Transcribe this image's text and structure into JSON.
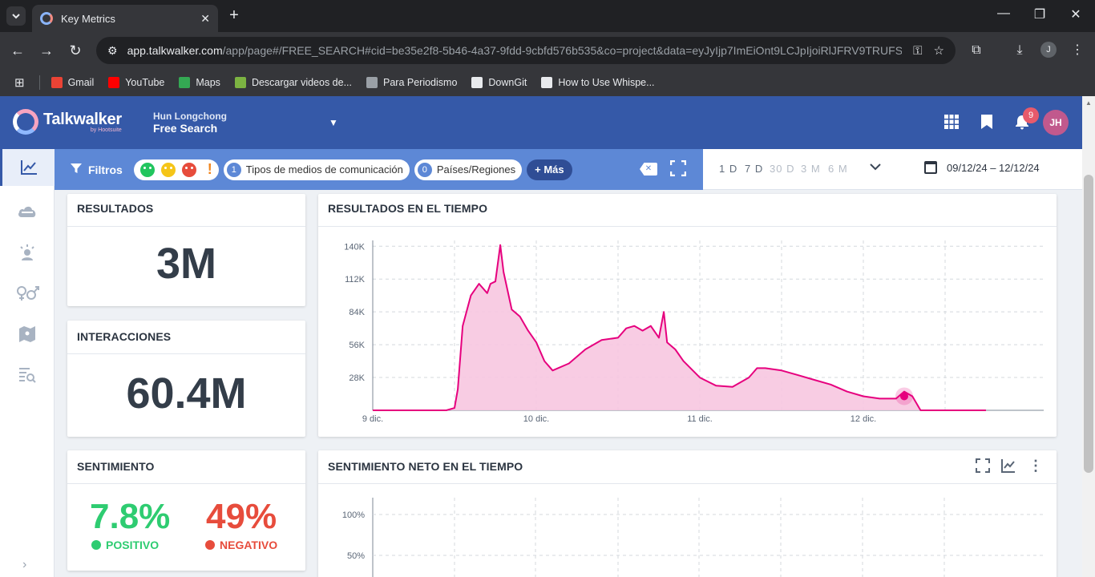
{
  "browser": {
    "tab_title": "Key Metrics",
    "url_host": "app.talkwalker.com",
    "url_path": "/app/page#/FREE_SEARCH#cid=be35e2f8-5b46-4a37-9fdd-9cbfd576b535&co=project&data=eyJyIjp7ImEiOnt9LCJpIjoiRlJFRV9TRUFS...",
    "profile_initial": "J",
    "bookmarks": [
      {
        "label": "Gmail",
        "color": "#ea4335"
      },
      {
        "label": "YouTube",
        "color": "#ff0000"
      },
      {
        "label": "Maps",
        "color": "#34a853"
      },
      {
        "label": "Descargar videos de...",
        "color": "#7cb342"
      },
      {
        "label": "Para Periodismo",
        "color": "#9aa0a6"
      },
      {
        "label": "DownGit",
        "color": "#e8eaed"
      },
      {
        "label": "How to Use Whispe...",
        "color": "#e8eaed"
      }
    ]
  },
  "header": {
    "logo_text": "Talkwalker",
    "logo_sub": "by Hootsuite",
    "user_name": "Hun Longchong",
    "project_name": "Free Search",
    "notification_count": "9",
    "avatar_initials": "JH"
  },
  "filters": {
    "label": "Filtros",
    "media_types_count": "1",
    "media_types_label": "Tipos de medios de comunicación",
    "countries_count": "0",
    "countries_label": "Países/Regiones",
    "more_label": "+ Más",
    "sentiment_colors": {
      "positive": "#22c55e",
      "neutral": "#f5c518",
      "negative": "#e74c3c",
      "warning": "#f0861f"
    }
  },
  "timerange": {
    "options": [
      "1 D",
      "7 D",
      "30 D",
      "3 M",
      "6 M"
    ],
    "date_range": "09/12/24 – 12/12/24"
  },
  "cards": {
    "results": {
      "title": "RESULTADOS",
      "value": "3M"
    },
    "interactions": {
      "title": "INTERACCIONES",
      "value": "60.4M"
    },
    "sentiment": {
      "title": "SENTIMIENTO",
      "positive_value": "7.8%",
      "positive_label": "POSITIVO",
      "negative_value": "49%",
      "negative_label": "NEGATIVO",
      "positive_color": "#2ecc71",
      "negative_color": "#e74c3c"
    },
    "results_over_time": {
      "title": "RESULTADOS EN EL TIEMPO"
    },
    "net_sentiment_over_time": {
      "title": "SENTIMIENTO NETO EN EL TIEMPO",
      "y_ticks": [
        "100%",
        "50%"
      ]
    }
  },
  "chart_data": {
    "type": "area",
    "title": "RESULTADOS EN EL TIEMPO",
    "xlabel": "",
    "ylabel": "",
    "x_ticks": [
      "9 dic.",
      "10 dic.",
      "11 dic.",
      "12 dic."
    ],
    "y_ticks": [
      "28K",
      "56K",
      "84K",
      "112K",
      "140K"
    ],
    "ylim": [
      0,
      145000
    ],
    "xlim": [
      0,
      4
    ],
    "color": "#e6007e",
    "series": [
      {
        "x": [
          0,
          0.2,
          0.35,
          0.45,
          0.5,
          0.52,
          0.55,
          0.6,
          0.65,
          0.7,
          0.72,
          0.75,
          0.78,
          0.8,
          0.85,
          0.9,
          0.95,
          1.0,
          1.05,
          1.1,
          1.2,
          1.3,
          1.4,
          1.5,
          1.55,
          1.6,
          1.65,
          1.7,
          1.75,
          1.78,
          1.8,
          1.85,
          1.9,
          2.0,
          2.1,
          2.2,
          2.3,
          2.35,
          2.4,
          2.5,
          2.6,
          2.7,
          2.8,
          2.9,
          3.0,
          3.1,
          3.2,
          3.25,
          3.3,
          3.35,
          3.4,
          3.5,
          3.6,
          3.75
        ],
        "y": [
          0,
          0,
          0,
          0,
          2000,
          18000,
          72000,
          98000,
          108000,
          100000,
          108000,
          110000,
          141000,
          118000,
          86000,
          80000,
          68000,
          58000,
          42000,
          34000,
          40000,
          52000,
          60000,
          62000,
          70000,
          72000,
          68000,
          72000,
          62000,
          84000,
          58000,
          52000,
          42000,
          28000,
          21000,
          20000,
          28000,
          36000,
          36000,
          34000,
          30000,
          26000,
          22000,
          16000,
          12000,
          10000,
          10000,
          16000,
          12000,
          0,
          0,
          0,
          0,
          0
        ]
      }
    ],
    "highlight_point": {
      "x": 3.25,
      "y": 12000
    }
  }
}
